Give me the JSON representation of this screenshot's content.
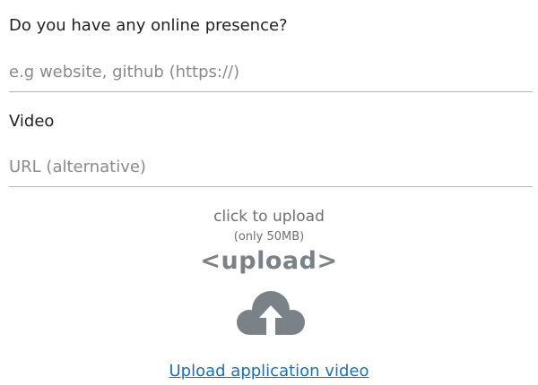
{
  "form": {
    "presence": {
      "label": "Do you have any online presence?",
      "placeholder": "e.g website, github (https://)",
      "value": ""
    },
    "video": {
      "label": "Video",
      "placeholder": "URL (alternative)",
      "value": ""
    }
  },
  "upload": {
    "click_text": "click to upload",
    "limit_text": "(only 50MB)",
    "code_text": "<upload>",
    "icon": "cloud-upload-icon",
    "link_text": "Upload application video"
  },
  "colors": {
    "link": "#1c6fb5",
    "icon": "#7a8288",
    "muted_text": "#6f6f6f",
    "divider": "#b5b5b5"
  }
}
